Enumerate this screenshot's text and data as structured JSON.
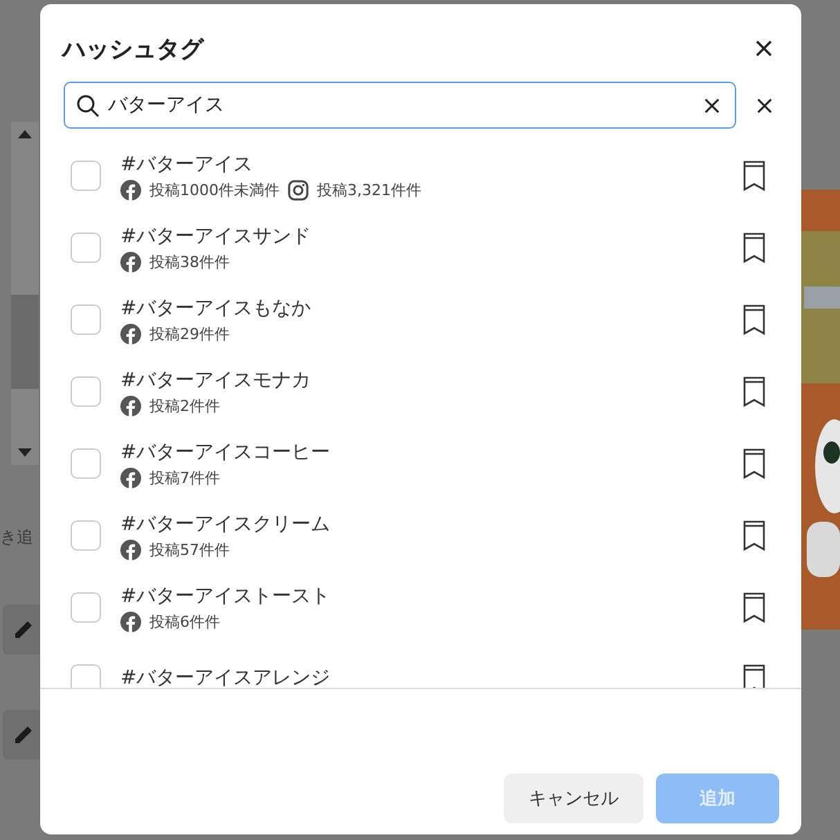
{
  "background": {
    "note_text": "き追"
  },
  "dialog": {
    "title": "ハッシュタグ",
    "search": {
      "value": "バターアイス"
    },
    "results": [
      {
        "tag": "#バターアイス",
        "selected": false,
        "bookmarked": false,
        "stats": [
          {
            "kind": "facebook",
            "text": "投稿1000件未満件"
          },
          {
            "kind": "instagram",
            "text": "投稿3,321件件"
          }
        ]
      },
      {
        "tag": "#バターアイスサンド",
        "selected": false,
        "bookmarked": false,
        "stats": [
          {
            "kind": "facebook",
            "text": "投稿38件件"
          }
        ]
      },
      {
        "tag": "#バターアイスもなか",
        "selected": false,
        "bookmarked": false,
        "stats": [
          {
            "kind": "facebook",
            "text": "投稿29件件"
          }
        ]
      },
      {
        "tag": "#バターアイスモナカ",
        "selected": false,
        "bookmarked": false,
        "stats": [
          {
            "kind": "facebook",
            "text": "投稿2件件"
          }
        ]
      },
      {
        "tag": "#バターアイスコーヒー",
        "selected": false,
        "bookmarked": false,
        "stats": [
          {
            "kind": "facebook",
            "text": "投稿7件件"
          }
        ]
      },
      {
        "tag": "#バターアイスクリーム",
        "selected": false,
        "bookmarked": false,
        "stats": [
          {
            "kind": "facebook",
            "text": "投稿57件件"
          }
        ]
      },
      {
        "tag": "#バターアイストースト",
        "selected": false,
        "bookmarked": false,
        "stats": [
          {
            "kind": "facebook",
            "text": "投稿6件件"
          }
        ]
      },
      {
        "tag": "#バターアイスアレンジ",
        "selected": false,
        "bookmarked": false
      }
    ],
    "buttons": [
      {
        "kind": "secondary",
        "label": "キャンセル"
      },
      {
        "kind": "primary",
        "label": "追加",
        "disabled": true
      }
    ]
  }
}
